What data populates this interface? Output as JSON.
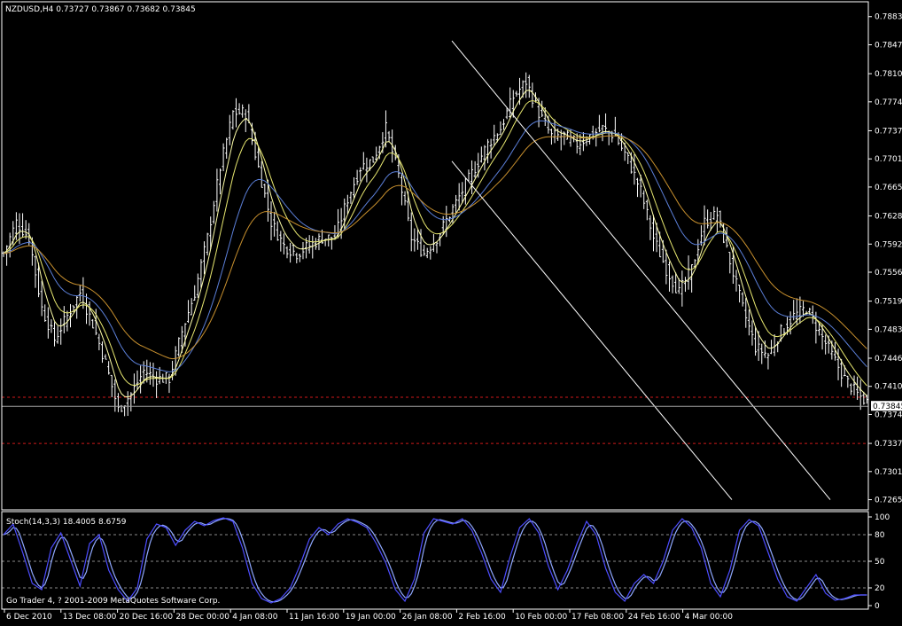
{
  "header": {
    "symbol_line": "NZDUSD,H4  0.73727 0.73867 0.73682 0.73845"
  },
  "indicator": {
    "label": "Stoch(14,3,3) 18.4005 8.6759"
  },
  "footer": {
    "copyright": "Go Trader 4, ? 2001-2009 MetaQuotes Software Corp."
  },
  "colors": {
    "background": "#000000",
    "axis": "#ffffff",
    "bars": "#ffffff",
    "ma_fast": "#ffffaa",
    "ma_mid": "#e8e870",
    "ma_blue": "#5b7fd8",
    "ma_orange": "#c8902e",
    "stoch_main": "#4d4dff",
    "stoch_signal": "#8fa8ff",
    "level_line": "#d0191a",
    "grid_dash": "#8a8a8a"
  },
  "chart_data": [
    {
      "type": "line",
      "title": "NZDUSD,H4",
      "price_ticks": [
        "0.78830",
        "0.78470",
        "0.78100",
        "0.77740",
        "0.77370",
        "0.77010",
        "0.76650",
        "0.76280",
        "0.75920",
        "0.75560",
        "0.75190",
        "0.74830",
        "0.74460",
        "0.74100",
        "0.73740",
        "0.73370",
        "0.73010",
        "0.72650"
      ],
      "current_price": "0.73845",
      "ylim": [
        0.7252,
        0.7902
      ],
      "time_labels": [
        "6 Dec 2010",
        "13 Dec 08:00",
        "20 Dec 16:00",
        "28 Dec 00:00",
        "4 Jan 08:00",
        "11 Jan 16:00",
        "19 Jan 00:00",
        "26 Jan 08:00",
        "2 Feb 16:00",
        "10 Feb 00:00",
        "17 Feb 08:00",
        "24 Feb 16:00",
        "4 Mar 00:00"
      ],
      "close_path": [
        [
          0,
          0.758
        ],
        [
          4,
          0.762
        ],
        [
          8,
          0.76
        ],
        [
          12,
          0.751
        ],
        [
          16,
          0.747
        ],
        [
          20,
          0.75
        ],
        [
          24,
          0.753
        ],
        [
          28,
          0.749
        ],
        [
          32,
          0.744
        ],
        [
          36,
          0.738
        ],
        [
          40,
          0.74
        ],
        [
          44,
          0.743
        ],
        [
          48,
          0.742
        ],
        [
          52,
          0.742
        ],
        [
          56,
          0.748
        ],
        [
          60,
          0.753
        ],
        [
          64,
          0.76
        ],
        [
          68,
          0.769
        ],
        [
          72,
          0.776
        ],
        [
          76,
          0.776
        ],
        [
          80,
          0.769
        ],
        [
          84,
          0.762
        ],
        [
          88,
          0.759
        ],
        [
          92,
          0.758
        ],
        [
          96,
          0.759
        ],
        [
          100,
          0.76
        ],
        [
          104,
          0.76
        ],
        [
          108,
          0.765
        ],
        [
          112,
          0.769
        ],
        [
          116,
          0.77
        ],
        [
          120,
          0.774
        ],
        [
          124,
          0.768
        ],
        [
          128,
          0.76
        ],
        [
          132,
          0.758
        ],
        [
          136,
          0.76
        ],
        [
          140,
          0.763
        ],
        [
          144,
          0.766
        ],
        [
          148,
          0.769
        ],
        [
          152,
          0.772
        ],
        [
          156,
          0.774
        ],
        [
          160,
          0.778
        ],
        [
          164,
          0.78
        ],
        [
          168,
          0.776
        ],
        [
          172,
          0.773
        ],
        [
          176,
          0.773
        ],
        [
          180,
          0.772
        ],
        [
          184,
          0.773
        ],
        [
          188,
          0.774
        ],
        [
          192,
          0.773
        ],
        [
          196,
          0.77
        ],
        [
          200,
          0.766
        ],
        [
          204,
          0.76
        ],
        [
          208,
          0.756
        ],
        [
          212,
          0.753
        ],
        [
          216,
          0.756
        ],
        [
          220,
          0.762
        ],
        [
          224,
          0.763
        ],
        [
          228,
          0.757
        ],
        [
          232,
          0.751
        ],
        [
          236,
          0.746
        ],
        [
          240,
          0.745
        ],
        [
          244,
          0.748
        ],
        [
          248,
          0.75
        ],
        [
          252,
          0.751
        ],
        [
          256,
          0.748
        ],
        [
          260,
          0.745
        ],
        [
          264,
          0.742
        ],
        [
          268,
          0.74
        ],
        [
          271,
          0.739
        ]
      ],
      "levels": [
        0.7396,
        0.7337
      ],
      "channel": {
        "upper": [
          [
            0,
            0.7852
          ],
          [
            244,
            0.7265
          ]
        ],
        "lower": [
          [
            0,
            0.7698
          ],
          [
            214,
            0.7265
          ]
        ]
      },
      "series": []
    },
    {
      "type": "line",
      "title": "Stoch(14,3,3) 18.4005 8.6759",
      "ylim": [
        0,
        100
      ],
      "levels": [
        80,
        50,
        20
      ],
      "tick_labels": [
        "100",
        "80",
        "50",
        "20",
        "0"
      ],
      "stoch_path": [
        [
          0,
          80
        ],
        [
          3,
          92
        ],
        [
          6,
          60
        ],
        [
          9,
          25
        ],
        [
          12,
          18
        ],
        [
          15,
          65
        ],
        [
          18,
          82
        ],
        [
          21,
          52
        ],
        [
          24,
          22
        ],
        [
          27,
          70
        ],
        [
          30,
          80
        ],
        [
          33,
          40
        ],
        [
          36,
          18
        ],
        [
          39,
          5
        ],
        [
          42,
          20
        ],
        [
          45,
          75
        ],
        [
          48,
          92
        ],
        [
          51,
          88
        ],
        [
          54,
          68
        ],
        [
          57,
          85
        ],
        [
          60,
          95
        ],
        [
          63,
          90
        ],
        [
          66,
          96
        ],
        [
          69,
          99
        ],
        [
          72,
          95
        ],
        [
          75,
          65
        ],
        [
          78,
          25
        ],
        [
          81,
          8
        ],
        [
          84,
          3
        ],
        [
          87,
          8
        ],
        [
          90,
          20
        ],
        [
          93,
          45
        ],
        [
          96,
          75
        ],
        [
          99,
          88
        ],
        [
          102,
          80
        ],
        [
          105,
          92
        ],
        [
          108,
          98
        ],
        [
          111,
          94
        ],
        [
          114,
          88
        ],
        [
          117,
          70
        ],
        [
          120,
          48
        ],
        [
          123,
          18
        ],
        [
          126,
          5
        ],
        [
          129,
          30
        ],
        [
          132,
          82
        ],
        [
          135,
          98
        ],
        [
          138,
          95
        ],
        [
          141,
          92
        ],
        [
          144,
          98
        ],
        [
          147,
          85
        ],
        [
          150,
          60
        ],
        [
          153,
          30
        ],
        [
          156,
          15
        ],
        [
          159,
          55
        ],
        [
          162,
          88
        ],
        [
          165,
          98
        ],
        [
          168,
          82
        ],
        [
          171,
          45
        ],
        [
          174,
          18
        ],
        [
          177,
          40
        ],
        [
          180,
          70
        ],
        [
          183,
          95
        ],
        [
          186,
          80
        ],
        [
          189,
          42
        ],
        [
          192,
          15
        ],
        [
          195,
          5
        ],
        [
          198,
          25
        ],
        [
          201,
          35
        ],
        [
          204,
          25
        ],
        [
          207,
          50
        ],
        [
          210,
          85
        ],
        [
          213,
          98
        ],
        [
          216,
          88
        ],
        [
          219,
          65
        ],
        [
          222,
          25
        ],
        [
          225,
          10
        ],
        [
          228,
          40
        ],
        [
          231,
          85
        ],
        [
          234,
          97
        ],
        [
          237,
          90
        ],
        [
          240,
          60
        ],
        [
          243,
          30
        ],
        [
          246,
          10
        ],
        [
          249,
          5
        ],
        [
          252,
          20
        ],
        [
          255,
          35
        ],
        [
          258,
          14
        ],
        [
          261,
          6
        ],
        [
          264,
          8
        ],
        [
          267,
          12
        ]
      ]
    }
  ]
}
